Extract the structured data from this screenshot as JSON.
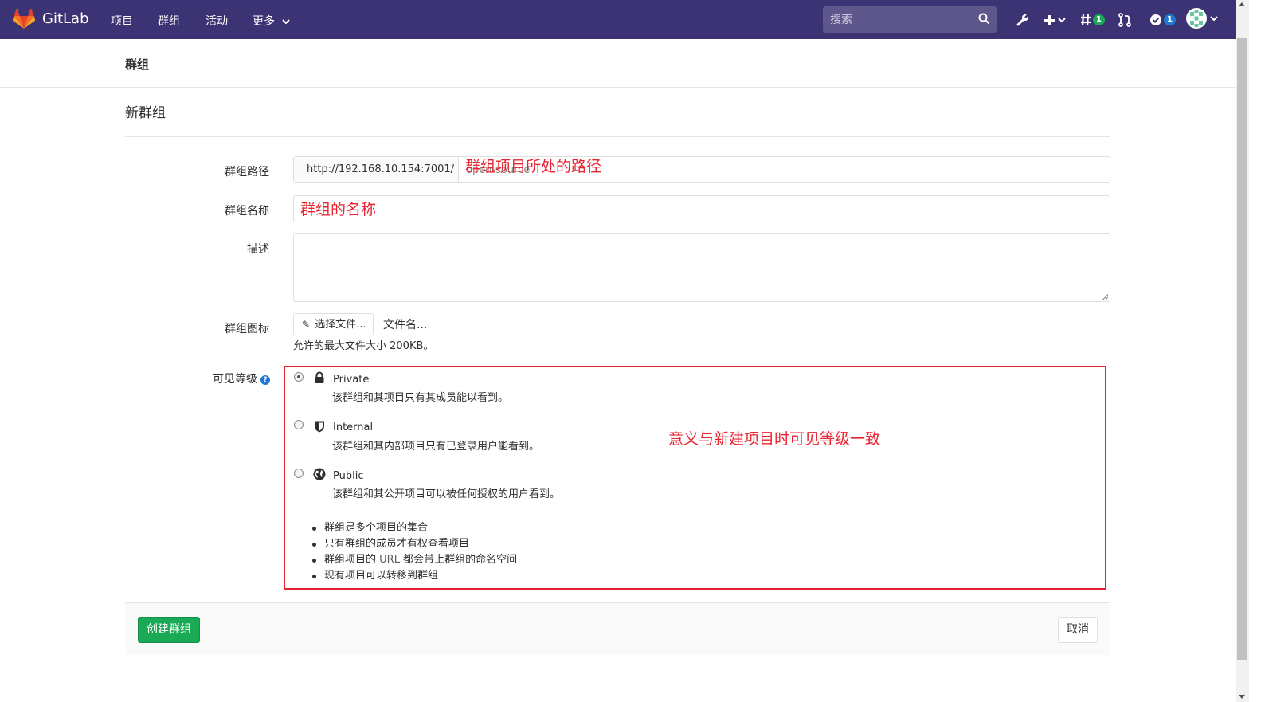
{
  "navbar": {
    "brand": "GitLab",
    "items": [
      {
        "label": "项目"
      },
      {
        "label": "群组"
      },
      {
        "label": "活动"
      },
      {
        "label": "更多"
      }
    ],
    "search_placeholder": "搜索",
    "todos_badge": "1",
    "issues_badge": "1"
  },
  "breadcrumb": "群组",
  "page_title": "新群组",
  "form": {
    "path_label": "群组路径",
    "path_prefix": "http://192.168.10.154:7001/",
    "path_value": "open-source",
    "path_annotation": "群组项目所处的路径",
    "name_label": "群组名称",
    "name_annotation": "群组的名称",
    "description_label": "描述",
    "avatar_label": "群组图标",
    "choose_file_label": "选择文件...",
    "file_name": "文件名...",
    "file_hint": "允许的最大文件大小 200KB。",
    "visibility_label": "可见等级",
    "visibility_help": "?",
    "visibility_annotation": "意义与新建项目时可见等级一致",
    "visibility_options": [
      {
        "title": "Private",
        "desc": "该群组和其项目只有其成员能以看到。"
      },
      {
        "title": "Internal",
        "desc": "该群组和其内部项目只有已登录用户能看到。"
      },
      {
        "title": "Public",
        "desc": "该群组和其公开项目可以被任何授权的用户看到。"
      }
    ],
    "selected_visibility": "Private",
    "notes": [
      "群组是多个项目的集合",
      "只有群组的成员才有权查看项目",
      "群组项目的 ",
      "现有项目可以转移到群组"
    ],
    "notes_url_word": "URL",
    "notes_3_tail": " 都会带上群组的命名空间"
  },
  "buttons": {
    "create": "创建群组",
    "cancel": "取消"
  },
  "colors": {
    "navbar": "#3b3373",
    "create_button": "#1aaa55",
    "annotation": "#e8232f"
  }
}
